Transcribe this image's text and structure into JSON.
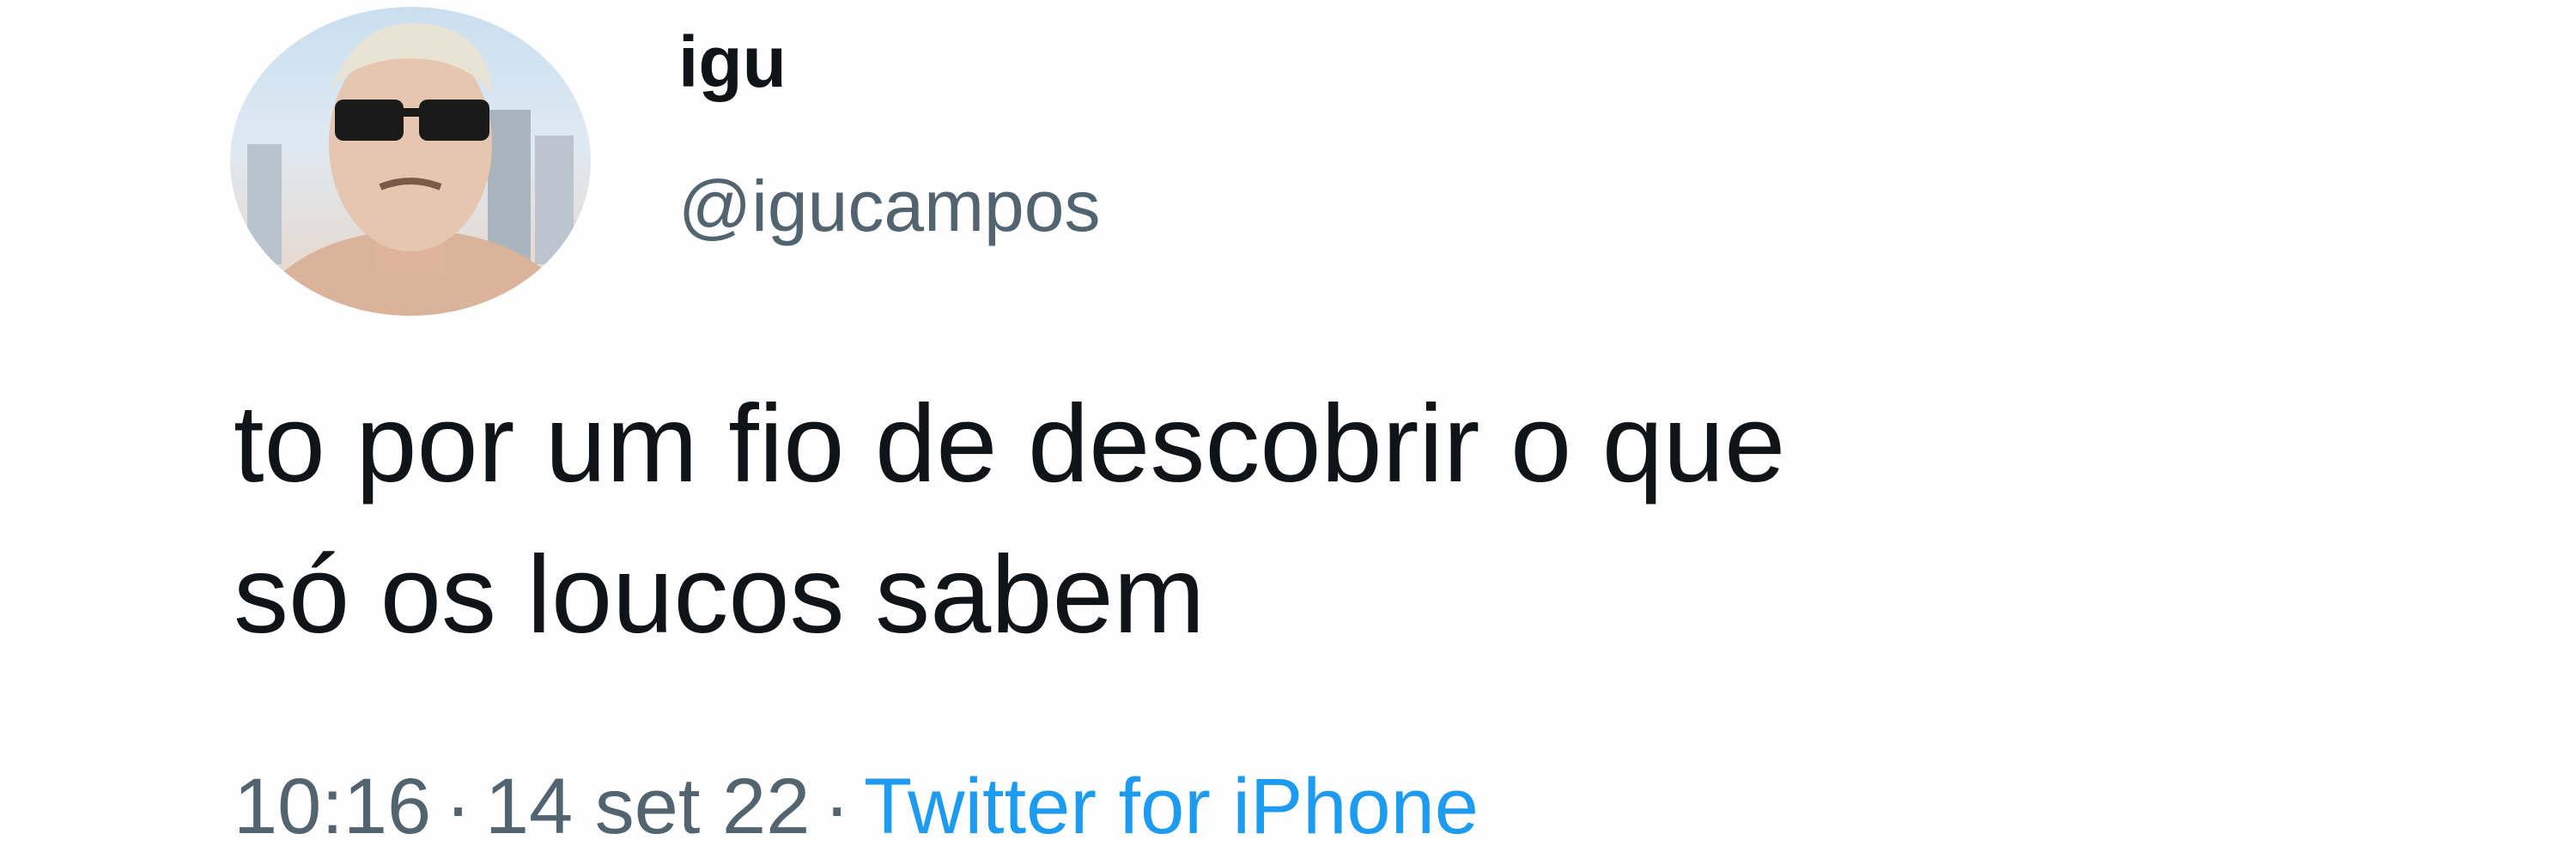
{
  "tweet": {
    "author": {
      "display_name": "igu",
      "handle": "@igucampos"
    },
    "text_line_1": "to por um fio de descobrir o que",
    "text_line_2": "só os loucos sabem",
    "meta": {
      "time": "10:16",
      "separator": "·",
      "date": "14 set 22",
      "source": "Twitter for iPhone"
    }
  },
  "colors": {
    "text": "#0f1419",
    "secondary": "#536471",
    "link": "#1d9bf0",
    "background": "#ffffff"
  },
  "icons": {
    "avatar": "profile-photo"
  }
}
